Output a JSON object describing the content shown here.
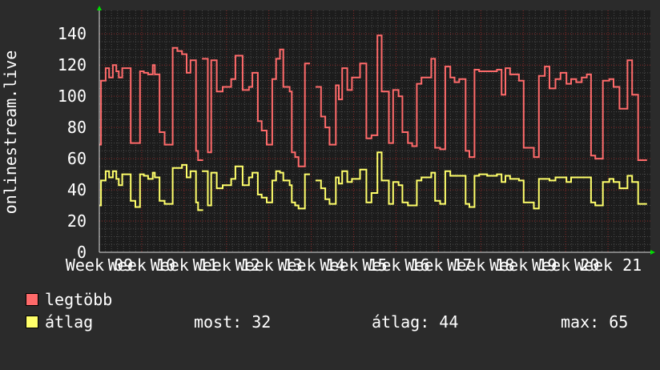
{
  "chart_data": {
    "type": "line",
    "ylabel": "onlinestream.live",
    "ylim": [
      0,
      155
    ],
    "yticks": [
      0,
      20,
      40,
      60,
      80,
      100,
      120,
      140
    ],
    "xticks": [
      "Week 09",
      "Week 10",
      "Week 11",
      "Week 12",
      "Week 13",
      "Week 14",
      "Week 15",
      "Week 16",
      "Week 17",
      "Week 18",
      "Week 19",
      "Week 20",
      "Week 21"
    ],
    "xlim": [
      0,
      13
    ],
    "grid": true,
    "series": [
      {
        "name": "legtöbb",
        "color": "#ff6a6a",
        "x": [
          0,
          0.04,
          0.15,
          0.23,
          0.32,
          0.4,
          0.46,
          0.54,
          0.74,
          0.85,
          0.96,
          1.05,
          1.15,
          1.26,
          1.31,
          1.42,
          1.54,
          1.73,
          1.84,
          1.95,
          2.06,
          2.15,
          2.28,
          2.33,
          null,
          2.42,
          2.56,
          2.64,
          2.77,
          2.91,
          3.11,
          3.21,
          3.38,
          3.53,
          3.61,
          3.74,
          3.83,
          3.95,
          4.08,
          4.17,
          4.26,
          4.34,
          4.49,
          4.54,
          4.62,
          4.7,
          4.85,
          null,
          5.1,
          5.23,
          5.33,
          5.43,
          5.58,
          5.65,
          5.73,
          5.85,
          5.96,
          6.15,
          6.3,
          6.42,
          6.56,
          6.66,
          6.83,
          6.93,
          7.06,
          7.15,
          7.28,
          7.38,
          7.49,
          7.6,
          7.69,
          7.83,
          7.92,
          8.04,
          8.16,
          8.28,
          8.38,
          8.49,
          8.64,
          8.73,
          8.85,
          8.96,
          9.15,
          9.26,
          9.38,
          9.49,
          9.58,
          9.69,
          9.9,
          10.01,
          10.12,
          10.25,
          10.37,
          10.51,
          10.62,
          10.76,
          10.88,
          11.02,
          11.13,
          11.25,
          11.38,
          11.5,
          11.6,
          11.7,
          11.88,
          12.03,
          12.13,
          12.27,
          12.38,
          12.46,
          12.57,
          12.71,
          12.79,
          12.92
        ],
        "y": [
          69,
          110,
          118,
          112,
          120,
          116,
          112,
          118,
          70,
          70,
          116,
          115,
          114,
          120,
          114,
          77,
          69,
          131,
          129,
          127,
          115,
          123,
          65,
          59,
          108,
          124,
          64,
          123,
          103,
          106,
          111,
          126,
          104,
          106,
          115,
          84,
          78,
          69,
          111,
          124,
          130,
          106,
          103,
          64,
          61,
          55,
          121,
          117,
          106,
          87,
          80,
          69,
          107,
          98,
          118,
          104,
          112,
          121,
          73,
          75,
          139,
          103,
          70,
          104,
          100,
          77,
          70,
          68,
          108,
          112,
          112,
          124,
          67,
          66,
          119,
          112,
          109,
          111,
          65,
          61,
          117,
          116,
          116,
          116,
          117,
          101,
          118,
          114,
          110,
          67,
          67,
          61,
          113,
          119,
          105,
          111,
          115,
          108,
          111,
          109,
          112,
          114,
          62,
          60,
          110,
          111,
          106,
          92,
          92,
          123,
          101,
          59,
          59,
          59
        ]
      },
      {
        "name": "átlag",
        "color": "#ffff6a",
        "x": [
          0,
          0.04,
          0.15,
          0.23,
          0.32,
          0.4,
          0.46,
          0.54,
          0.74,
          0.85,
          0.96,
          1.05,
          1.15,
          1.26,
          1.31,
          1.42,
          1.54,
          1.73,
          1.84,
          1.95,
          2.06,
          2.15,
          2.28,
          2.33,
          null,
          2.42,
          2.56,
          2.64,
          2.77,
          2.91,
          3.11,
          3.21,
          3.38,
          3.53,
          3.61,
          3.74,
          3.83,
          3.95,
          4.08,
          4.17,
          4.26,
          4.34,
          4.49,
          4.54,
          4.62,
          4.7,
          4.85,
          null,
          5.1,
          5.23,
          5.33,
          5.43,
          5.58,
          5.65,
          5.73,
          5.85,
          5.96,
          6.15,
          6.3,
          6.42,
          6.56,
          6.66,
          6.83,
          6.93,
          7.06,
          7.15,
          7.28,
          7.38,
          7.49,
          7.6,
          7.69,
          7.83,
          7.92,
          8.04,
          8.16,
          8.28,
          8.38,
          8.49,
          8.64,
          8.73,
          8.85,
          8.96,
          9.15,
          9.26,
          9.38,
          9.49,
          9.58,
          9.69,
          9.9,
          10.01,
          10.12,
          10.25,
          10.37,
          10.51,
          10.62,
          10.76,
          10.88,
          11.02,
          11.13,
          11.25,
          11.38,
          11.5,
          11.6,
          11.7,
          11.88,
          12.03,
          12.13,
          12.27,
          12.38,
          12.46,
          12.57,
          12.71,
          12.79,
          12.92
        ],
        "y": [
          30,
          46,
          52,
          48,
          52,
          47,
          43,
          50,
          33,
          29,
          50,
          49,
          47,
          51,
          48,
          33,
          31,
          54,
          54,
          56,
          48,
          52,
          32,
          27,
          49,
          52,
          30,
          51,
          41,
          43,
          47,
          55,
          43,
          48,
          51,
          37,
          35,
          32,
          46,
          52,
          51,
          46,
          43,
          32,
          30,
          28,
          50,
          49,
          46,
          41,
          34,
          31,
          48,
          44,
          52,
          45,
          47,
          53,
          32,
          38,
          64,
          46,
          31,
          45,
          43,
          32,
          30,
          30,
          46,
          48,
          48,
          51,
          33,
          31,
          52,
          49,
          49,
          49,
          31,
          29,
          49,
          50,
          49,
          49,
          50,
          45,
          49,
          47,
          46,
          32,
          32,
          28,
          47,
          47,
          46,
          48,
          48,
          45,
          48,
          48,
          48,
          48,
          32,
          30,
          45,
          47,
          45,
          41,
          41,
          49,
          45,
          31,
          31,
          31
        ]
      }
    ]
  },
  "legend": {
    "max_label": "legtöbb",
    "avg_label": "átlag",
    "max_color": "#ff6a6a",
    "avg_color": "#ffff6a"
  },
  "stats": {
    "now": "most: 32",
    "average": "átlag: 44",
    "max": "max: 65"
  }
}
